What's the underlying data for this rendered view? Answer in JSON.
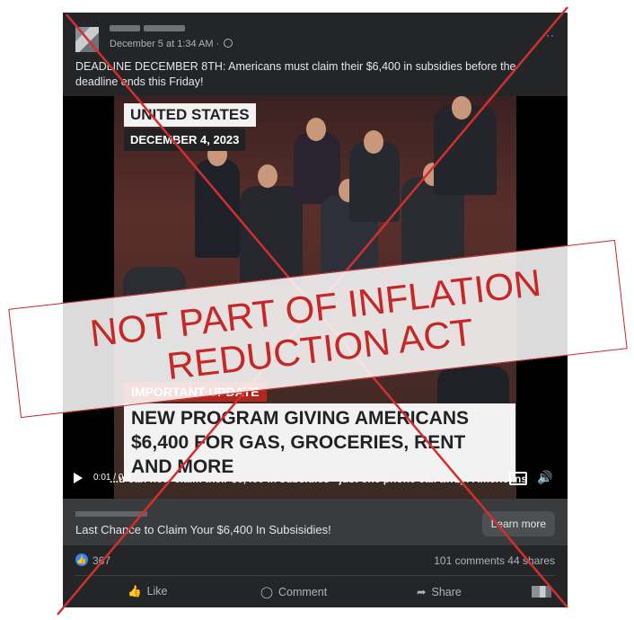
{
  "post": {
    "date": "December 5 at 1:34 AM ·",
    "menu": "··",
    "caption": "DEADLINE DECEMBER 8TH: Americans must claim their $6,400 in subsidies before the deadline ends this Friday!"
  },
  "video": {
    "tag_country": "UNITED STATES",
    "tag_date": "DECEMBER 4, 2023",
    "tag_update": "IMPORTANT UPDATE",
    "headline": "NEW PROGRAM GIVING AMERICANS $6,400 FOR GAS, GROCERIES, RENT AND MORE",
    "time": "0:01 / 0:3",
    "ticker": "...u can now claim their $6,400 in subsidies - just one phone call away! Americans"
  },
  "cta": {
    "title": "Last Chance to Claim Your $6,400 In Subsisidies!",
    "button": "Learn more"
  },
  "stats": {
    "likes": "367",
    "comments_shares": "101 comments  44 shares"
  },
  "actions": {
    "like": "Like",
    "comment": "Comment",
    "share": "Share"
  },
  "overlay": {
    "stamp": "NOT PART OF INFLATION REDUCTION ACT",
    "color": "#c62828"
  }
}
